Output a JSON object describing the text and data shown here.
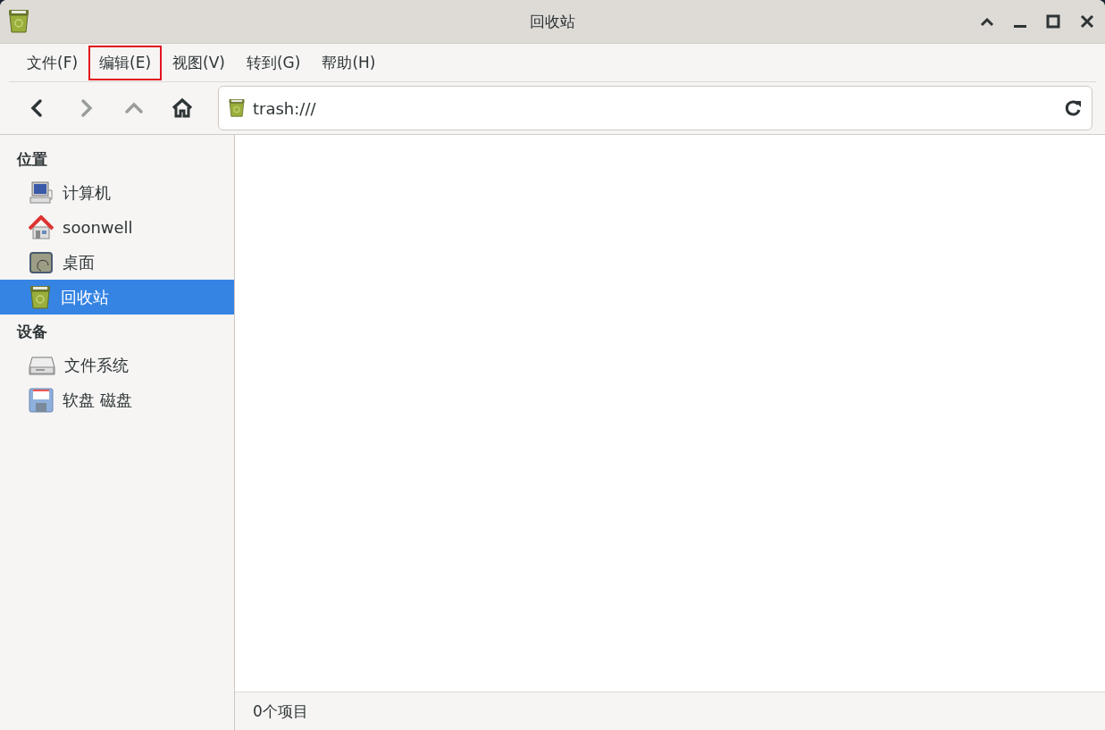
{
  "window": {
    "title": "回收站"
  },
  "menu": [
    {
      "label": "文件(F)",
      "highlighted": false
    },
    {
      "label": "编辑(E)",
      "highlighted": true
    },
    {
      "label": "视图(V)",
      "highlighted": false
    },
    {
      "label": "转到(G)",
      "highlighted": false
    },
    {
      "label": "帮助(H)",
      "highlighted": false
    }
  ],
  "toolbar": {
    "nav": [
      {
        "kind": "back",
        "disabled": false
      },
      {
        "kind": "forward",
        "disabled": true
      },
      {
        "kind": "up",
        "disabled": true
      },
      {
        "kind": "home",
        "disabled": false
      }
    ],
    "location": {
      "value": "trash:///"
    }
  },
  "sidebar": {
    "sections": [
      {
        "heading": "位置",
        "items": [
          {
            "label": "计算机",
            "kind": "computer",
            "selected": false
          },
          {
            "label": "soonwell",
            "kind": "home",
            "selected": false
          },
          {
            "label": "桌面",
            "kind": "desktop",
            "selected": false
          },
          {
            "label": "回收站",
            "kind": "trash",
            "selected": true
          }
        ]
      },
      {
        "heading": "设备",
        "items": [
          {
            "label": "文件系统",
            "kind": "drive",
            "selected": false
          },
          {
            "label": "软盘 磁盘",
            "kind": "floppy",
            "selected": false
          }
        ]
      }
    ]
  },
  "status_bar": {
    "text": "0个项目"
  }
}
